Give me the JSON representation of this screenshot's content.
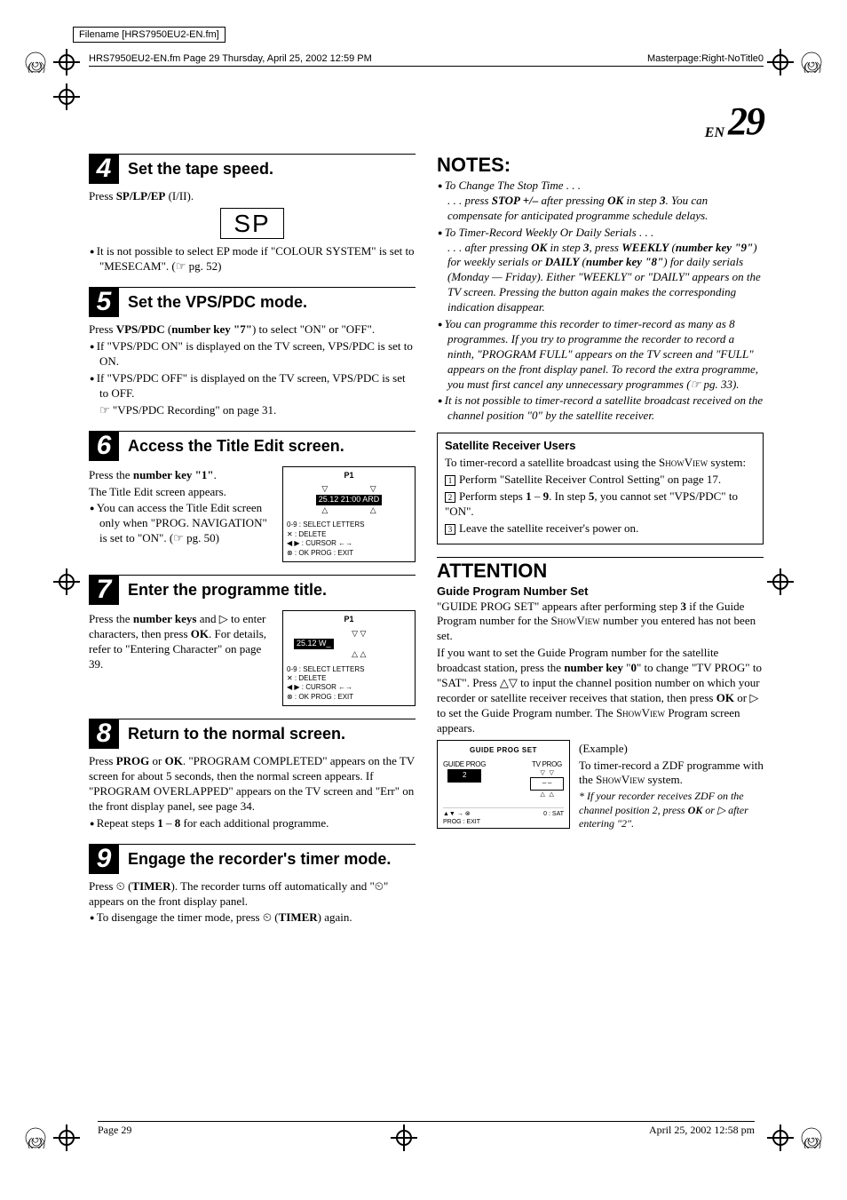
{
  "filename_label": "Filename [HRS7950EU2-EN.fm]",
  "header_left": "HRS7950EU2-EN.fm  Page 29  Thursday, April 25, 2002  12:59 PM",
  "header_right": "Masterpage:Right-NoTitle0",
  "page_en": "EN",
  "page_num": "29",
  "footer_left": "Page 29",
  "footer_right": "April 25, 2002 12:58 pm",
  "steps": {
    "s4": {
      "num": "4",
      "title": "Set the tape speed.",
      "press": "Press ",
      "press_b": "SP/LP/EP",
      "press_tail": " (I/II).",
      "sp": "SP",
      "bullet": "It is not possible to select EP mode if \"COLOUR SYSTEM\" is set to \"MESECAM\". (☞ pg. 52)"
    },
    "s5": {
      "num": "5",
      "title": "Set the VPS/PDC mode.",
      "p1a": "Press ",
      "p1b": "VPS/PDC",
      "p1c": " (",
      "p1d": "number key \"7\"",
      "p1e": ") to select \"ON\" or \"OFF\".",
      "b1": "If \"VPS/PDC ON\" is displayed on the TV screen, VPS/PDC is set to ON.",
      "b2": "If \"VPS/PDC OFF\" is displayed on the TV screen, VPS/PDC is set to OFF.",
      "ref": "☞ \"VPS/PDC Recording\" on page 31."
    },
    "s6": {
      "num": "6",
      "title": "Access the Title Edit screen.",
      "p1a": "Press the ",
      "p1b": "number key \"1\"",
      "p1c": ".",
      "p2": "The Title Edit screen appears.",
      "b1": "You can access the Title Edit screen only when \"PROG. NAVIGATION\" is set to \"ON\". (☞ pg. 50)",
      "fig": {
        "p": "P1",
        "line": "25.12   21:00 ARD",
        "l1": "0-9  : SELECT LETTERS",
        "l2": "✕   : DELETE",
        "l3": "◀ ▶ : CURSOR ←→",
        "l4": "⊗ : OK       PROG : EXIT"
      }
    },
    "s7": {
      "num": "7",
      "title": "Enter the programme title.",
      "p1a": "Press the ",
      "p1b": "number keys",
      "p1c": " and ▷ to enter characters, then press ",
      "p1d": "OK",
      "p1e": ". For details, refer to \"Entering Character\" on page 39.",
      "fig": {
        "p": "P1",
        "line": "25.12    W_",
        "l1": "0-9  : SELECT LETTERS",
        "l2": "✕   : DELETE",
        "l3": "◀ ▶ : CURSOR ←→",
        "l4": "⊗ : OK       PROG : EXIT"
      }
    },
    "s8": {
      "num": "8",
      "title": "Return to the normal screen.",
      "p1a": "Press ",
      "p1b": "PROG",
      "p1c": " or ",
      "p1d": "OK",
      "p1e": ". \"PROGRAM COMPLETED\" appears on the TV screen for about 5 seconds, then the normal screen appears. If \"PROGRAM OVERLAPPED\" appears on the TV screen and \"Err\" on the front display panel, see page 34.",
      "b1a": "Repeat steps ",
      "b1b": "1",
      "b1c": " – ",
      "b1d": "8",
      "b1e": " for each additional programme."
    },
    "s9": {
      "num": "9",
      "title": "Engage the recorder's timer mode.",
      "p1a": "Press ⏲ (",
      "p1b": "TIMER",
      "p1c": "). The recorder turns off automatically and \"⏲\" appears on the front display panel.",
      "b1a": "To disengage the timer mode, press ⏲ (",
      "b1b": "TIMER",
      "b1c": ") again."
    }
  },
  "notes": {
    "h": "NOTES:",
    "n1a": "To Change The Stop Time . . .",
    "n1b": ". . . press ",
    "n1c": "STOP +/–",
    "n1d": " after pressing ",
    "n1e": "OK",
    "n1f": " in step ",
    "n1g": "3",
    "n1h": ". You can compensate for anticipated programme schedule delays.",
    "n2a": "To Timer-Record Weekly Or Daily Serials . . .",
    "n2b": ". . . after pressing ",
    "n2c": "OK",
    "n2d": " in step ",
    "n2e": "3",
    "n2f": ", press ",
    "n2g": "WEEKLY",
    "n2h": " (",
    "n2i": "number key \"9\"",
    "n2j": ") for weekly serials or ",
    "n2k": "DAILY",
    "n2l": " (",
    "n2m": "number key \"8\"",
    "n2n": ") for daily serials (Monday — Friday). Either \"WEEKLY\" or \"DAILY\" appears on the TV screen. Pressing the button again makes the corresponding indication disappear.",
    "n3": "You can programme this recorder to timer-record as many as 8 programmes. If you try to programme the recorder to record a ninth, \"PROGRAM FULL\" appears on the TV screen and \"FULL\" appears on the front display panel. To record the extra programme, you must first cancel any unnecessary programmes (☞ pg. 33).",
    "n4": "It is not possible to timer-record a satellite broadcast received on the channel position \"0\" by the satellite receiver."
  },
  "sat": {
    "h": "Satellite Receiver Users",
    "intro_a": "To timer-record a satellite broadcast using the ",
    "intro_b": "ShowView",
    "intro_c": " system:",
    "i1": "Perform \"Satellite Receiver Control Setting\" on page 17.",
    "i2a": "Perform steps ",
    "i2b": "1",
    "i2c": " – ",
    "i2d": "9",
    "i2e": ". In step ",
    "i2f": "5",
    "i2g": ", you cannot set \"VPS/PDC\" to \"ON\".",
    "i3": "Leave the satellite receiver's power on."
  },
  "att": {
    "h": "ATTENTION",
    "sub": "Guide Program Number Set",
    "p1a": "\"GUIDE PROG SET\" appears after performing step ",
    "p1b": "3",
    "p1c": " if the Guide Program number for the ",
    "p1d": "ShowView",
    "p1e": " number you entered has not been set.",
    "p2a": "If you want to set the Guide Program number for the satellite broadcast station, press the ",
    "p2b": "number key",
    "p2c": " \"",
    "p2d": "0",
    "p2e": "\" to change \"TV PROG\" to \"SAT\". Press △▽ to input the channel position number on which your recorder or satellite receiver receives that station, then press ",
    "p2f": "OK",
    "p2g": " or ▷ to set the Guide Program number. The ",
    "p2h": "ShowView",
    "p2i": " Program screen appears.",
    "ex_h": "(Example)",
    "ex_p_a": "To timer-record a ZDF programme with the ",
    "ex_p_b": "ShowView",
    "ex_p_c": " system.",
    "ex_note_a": "* If your recorder receives ZDF on the channel position 2, press ",
    "ex_note_b": "OK",
    "ex_note_c": " or ▷ after entering \"2\".",
    "fig": {
      "title": "GUIDE PROG SET",
      "gp": "GUIDE PROG",
      "gp_v": "2",
      "tp": "TV PROG",
      "tp_v": "– –",
      "leg_l": "▲▼ → ⊗\nPROG : EXIT",
      "leg_r": "0 : SAT"
    }
  }
}
